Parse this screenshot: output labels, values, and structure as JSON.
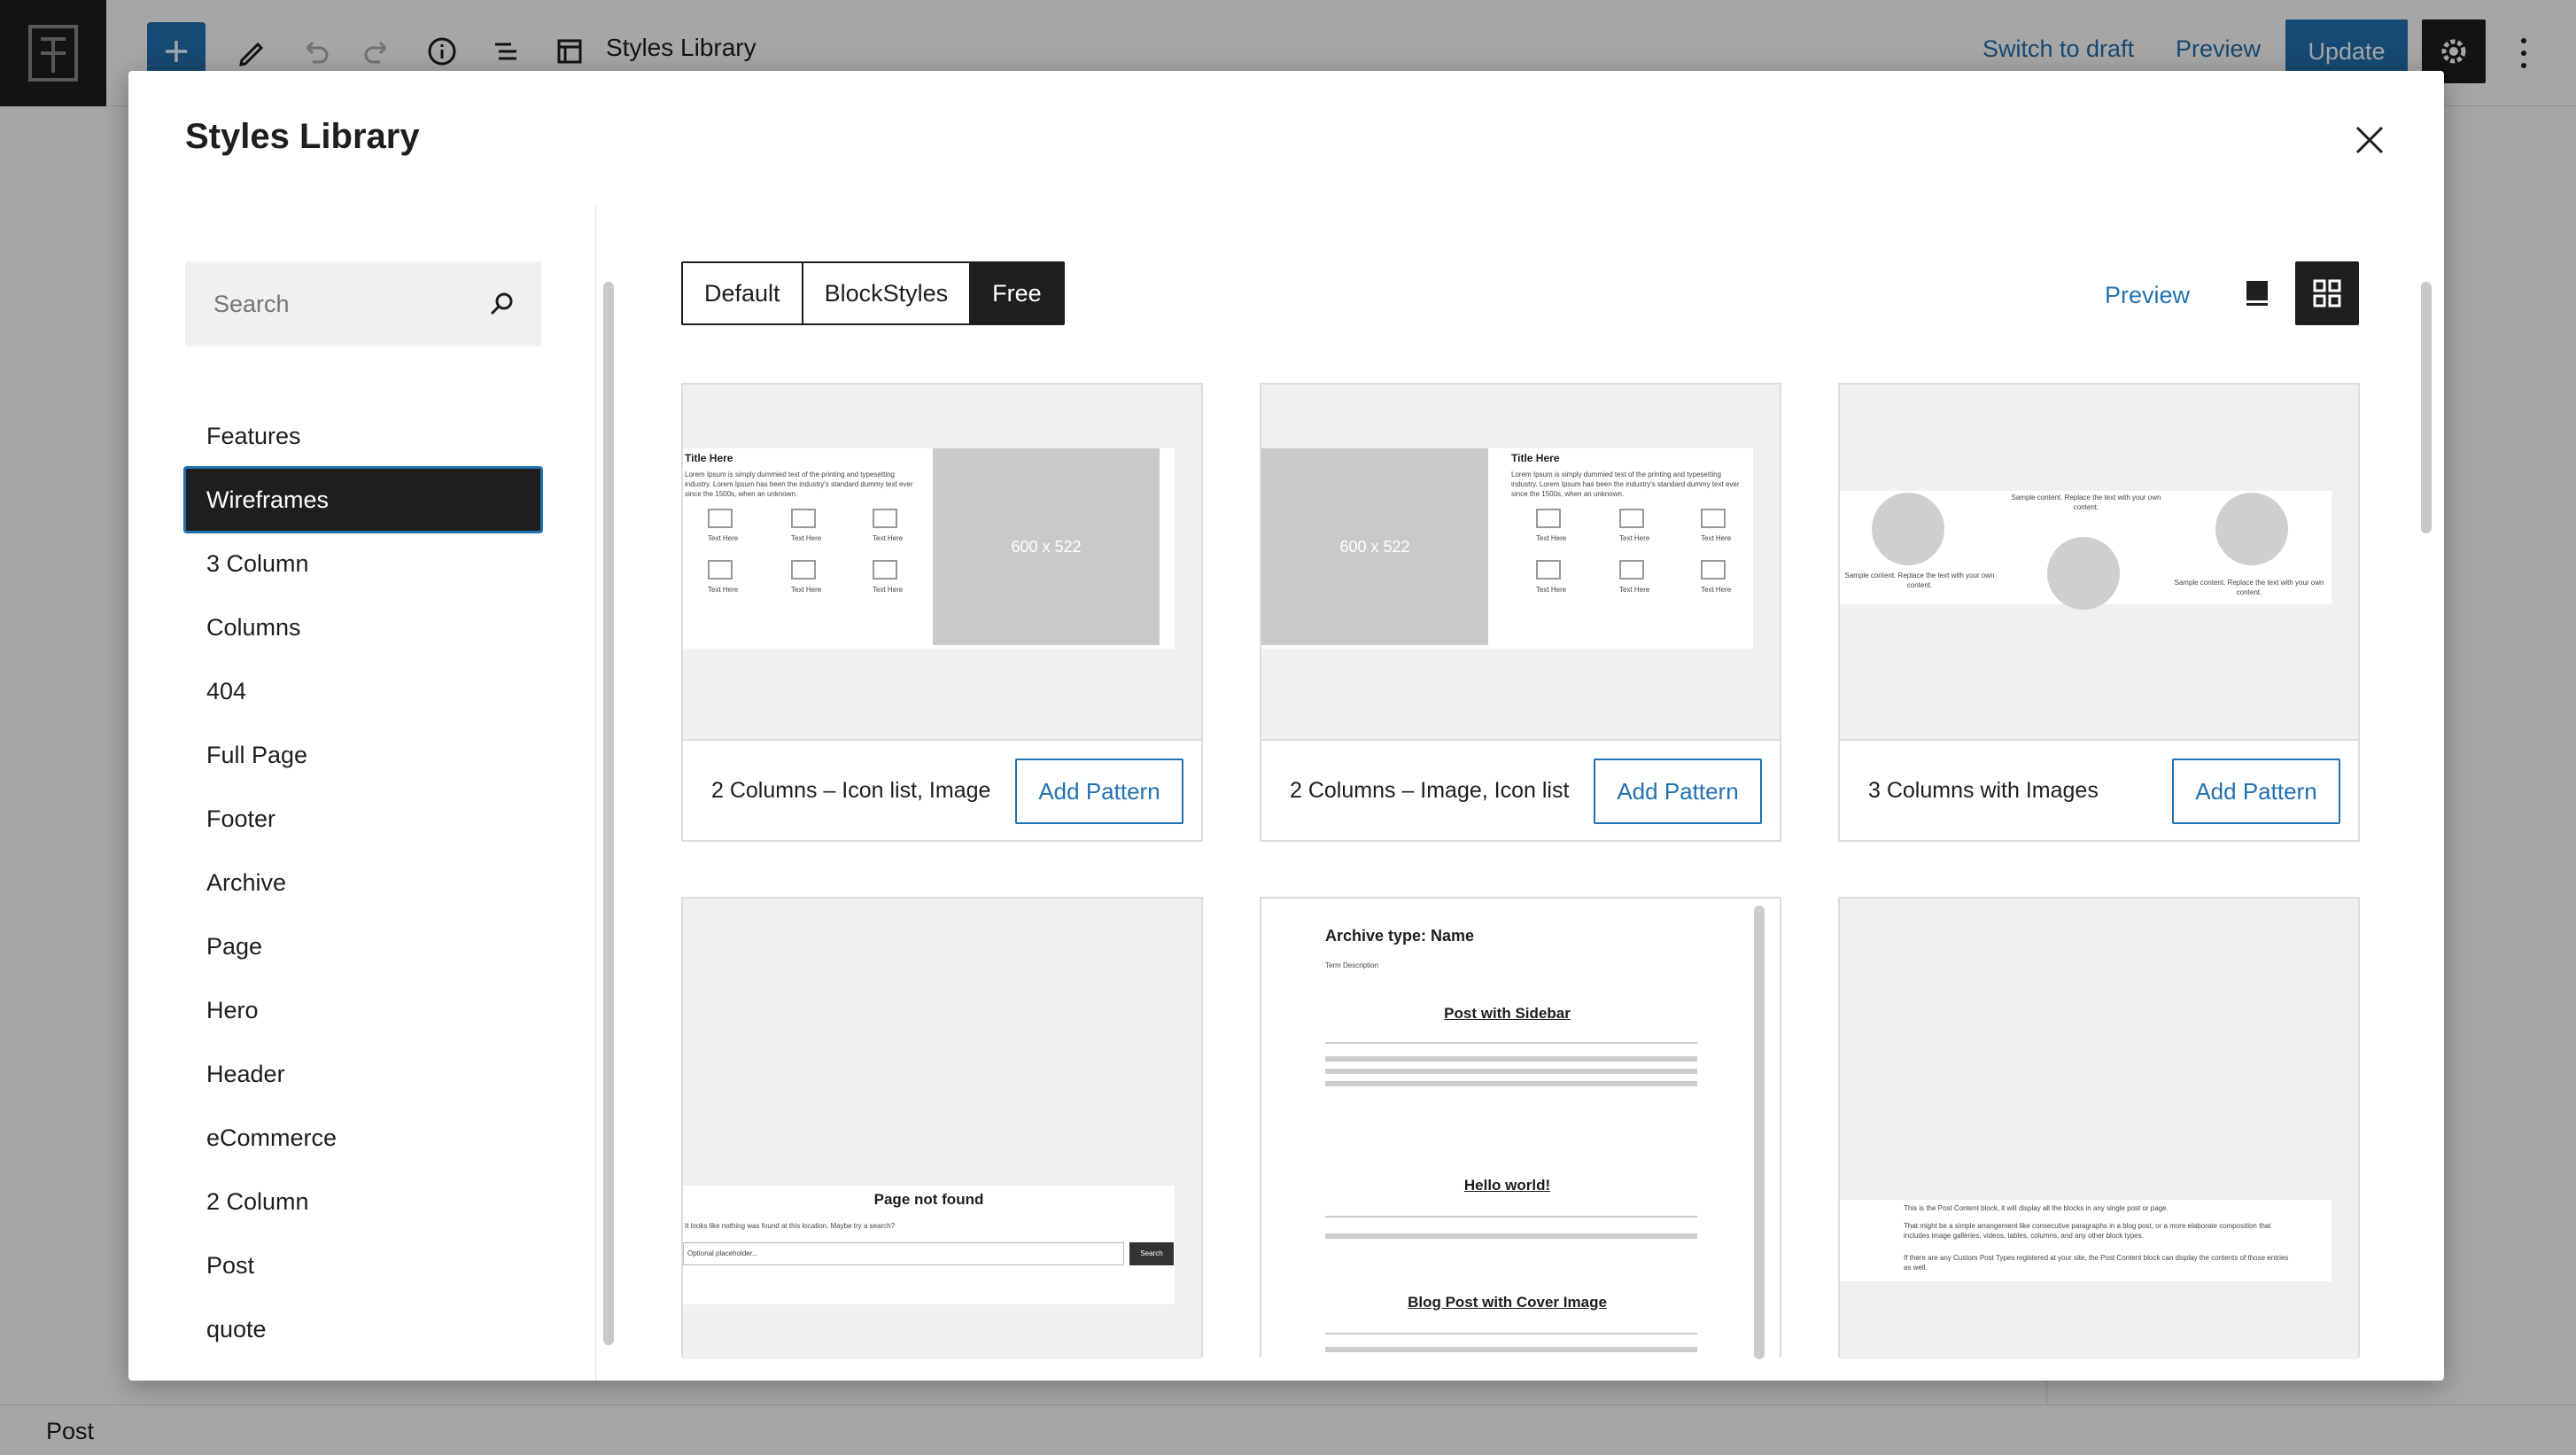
{
  "editor": {
    "doc_title": "Styles Library",
    "switch_draft": "Switch to draft",
    "preview": "Preview",
    "update": "Update",
    "status": "Post"
  },
  "modal": {
    "title": "Styles Library",
    "search_placeholder": "Search",
    "categories": [
      "Features",
      "Wireframes",
      "3 Column",
      "Columns",
      "404",
      "Full Page",
      "Footer",
      "Archive",
      "Page",
      "Hero",
      "Header",
      "eCommerce",
      "2 Column",
      "Post",
      "quote"
    ],
    "active_category": "Wireframes",
    "tabs": [
      "Default",
      "BlockStyles",
      "Free"
    ],
    "active_tab": "Free",
    "preview_label": "Preview",
    "add_label": "Add Pattern",
    "patterns": [
      {
        "name": "2 Columns – Icon list, Image"
      },
      {
        "name": "2 Columns – Image, Icon list"
      },
      {
        "name": "3 Columns with Images"
      }
    ],
    "previews": {
      "title_here": "Title Here",
      "lorem": "Lorem Ipsum is simply dummied text of the printing and typesetting industry. Lorem Ipsum has been the industry's standard dummy text ever since the 1500s, when an unknown.",
      "text_here": "Text Here",
      "img_size": "600 x 522",
      "sample": "Sample content. Replace the text with your own content.",
      "not_found_title": "Page not found",
      "not_found_text": "It looks like nothing was found at this location. Maybe try a search?",
      "search_placeholder": "Optional placeholder...",
      "search_btn": "Search",
      "archive_title": "Archive type: Name",
      "term_desc": "Term Description",
      "post1": "Post with Sidebar",
      "post2": "Hello world!",
      "post3": "Blog Post with Cover Image",
      "post_content_1": "This is the Post Content block, it will display all the blocks in any single post or page.",
      "post_content_2": "That might be a simple arrangement like consecutive paragraphs in a blog post, or a more elaborate composition that includes image galleries, videos, tables, columns, and any other block types.",
      "post_content_3": "If there are any Custom Post Types registered at your site, the Post Content block can display the contents of those entries as well."
    }
  },
  "colors": {
    "accent": "#2271b1",
    "dark": "#1e1e1e"
  }
}
